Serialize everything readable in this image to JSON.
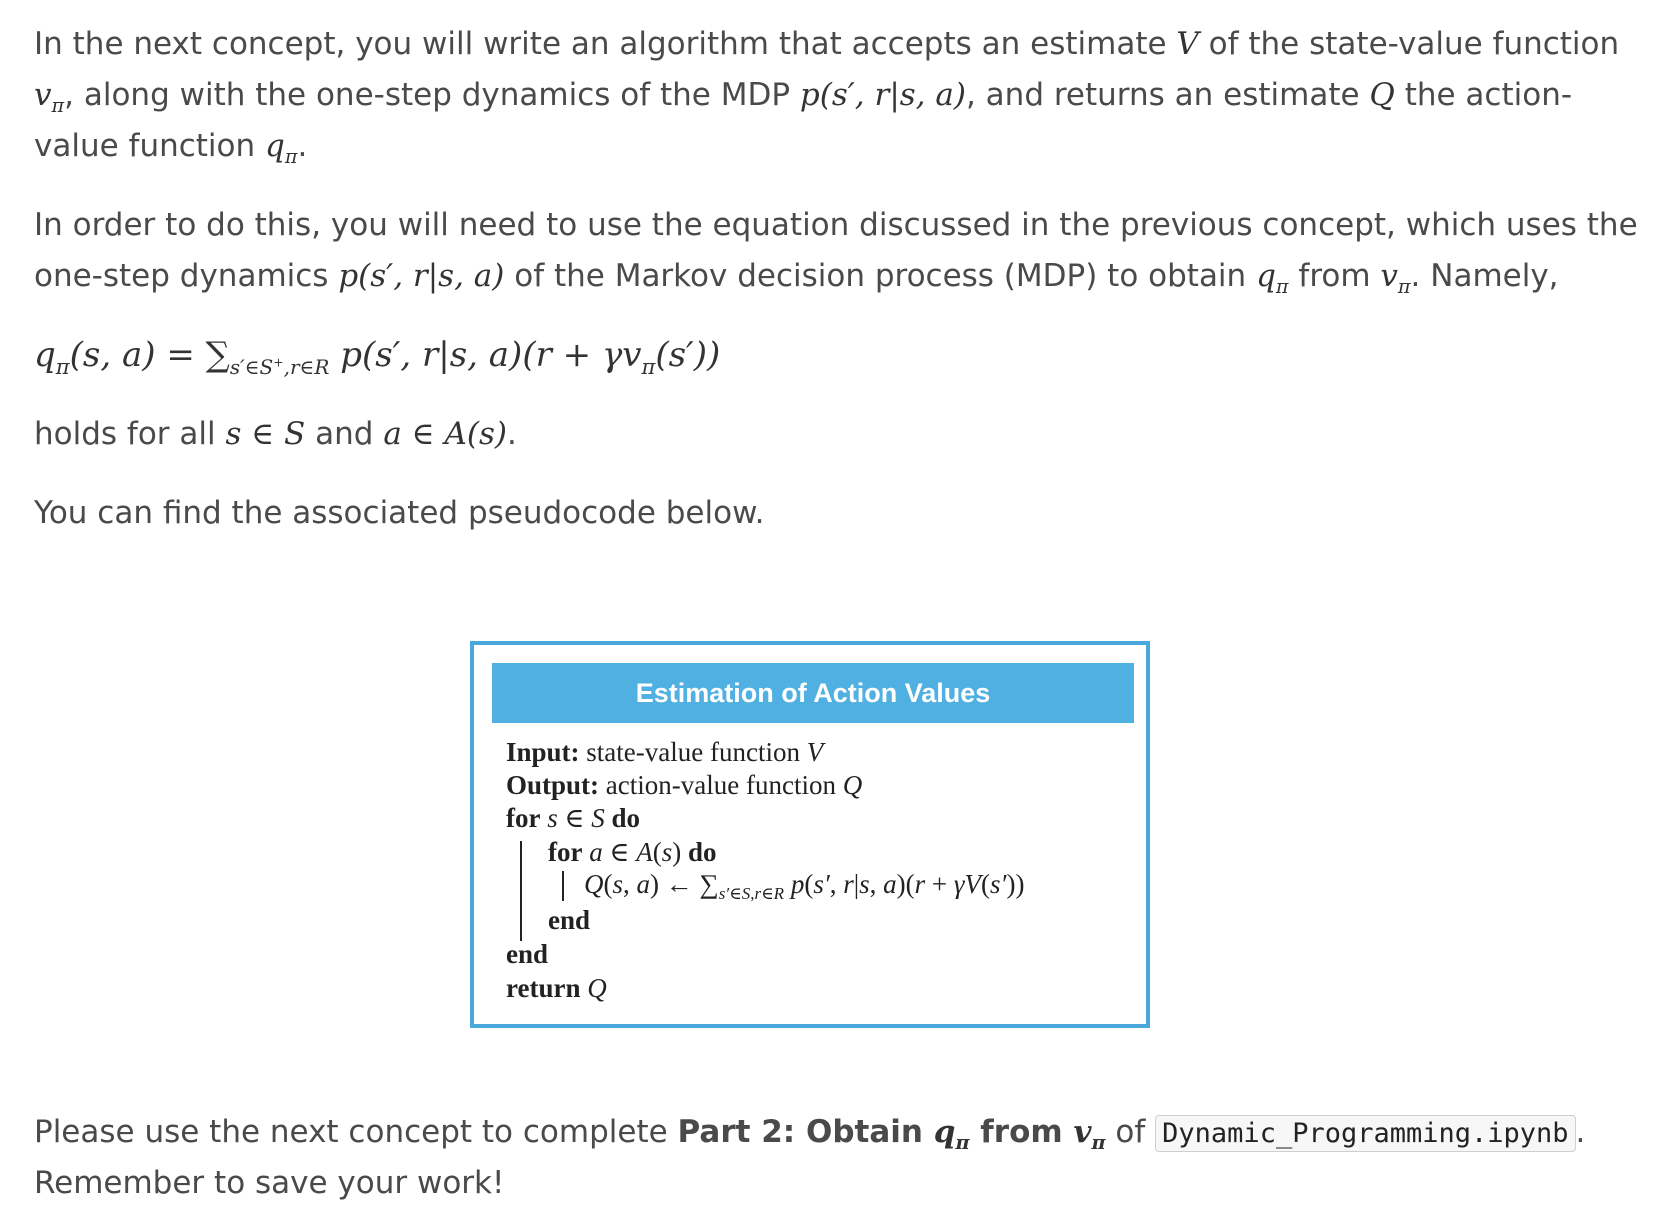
{
  "intro": {
    "line1_a": "In the next concept, you will write an algorithm that accepts an estimate ",
    "line1_b": " of the state-value function",
    "line2_a": ", along with the one-step dynamics of the MDP ",
    "line2_b": ", and returns an estimate ",
    "line2_c": " the action-",
    "line3_a": "value function "
  },
  "para2": {
    "line1": "In order to do this, you will need to use the equation discussed in the previous concept, which uses the",
    "line2_a": "one-step dynamics ",
    "line2_b": " of the Markov decision process (MDP) to obtain ",
    "line2_c": " from ",
    "line2_d": ". Namely,"
  },
  "holds": {
    "a": "holds for all ",
    "b": " and "
  },
  "pseudo_intro": "You can find the associated pseudocode below.",
  "algorithm": {
    "title": "Estimation of Action Values",
    "input_kw": "Input:",
    "input_text": "state-value function",
    "output_kw": "Output:",
    "output_text": "action-value function",
    "for_kw": "for",
    "do_kw": "do",
    "end_kw": "end",
    "return_kw": "return"
  },
  "footer": {
    "a": "Please use the next concept to complete ",
    "bold_a": "Part 2: Obtain ",
    "bold_b": " from ",
    "b": " of ",
    "filename": "Dynamic_Programming.ipynb",
    "c": ".",
    "line2": "Remember to save your work!"
  },
  "colors": {
    "box_border": "#4ba8dc",
    "title_bg": "#51b0e2"
  }
}
